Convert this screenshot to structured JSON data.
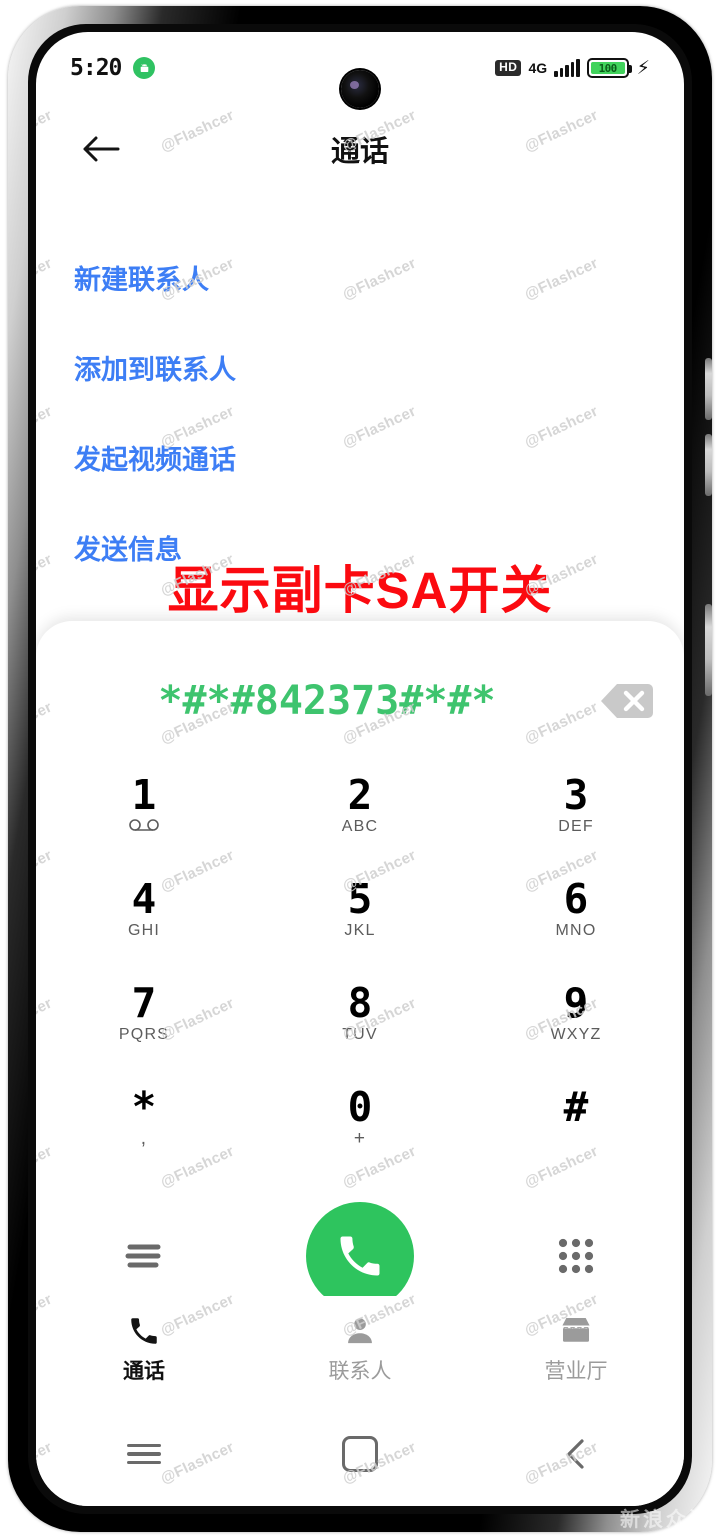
{
  "status_bar": {
    "clock": "5:20",
    "notification_icon": "android-robot-icon",
    "volte_badge": "HD",
    "network_type": "4G",
    "signal_icon": "signal-bars-icon",
    "battery_level": "100",
    "charging_icon": "charging-bolt-icon"
  },
  "header": {
    "back_icon": "back-arrow-icon",
    "title": "通话"
  },
  "action_links": [
    {
      "label": "新建联系人"
    },
    {
      "label": "添加到联系人"
    },
    {
      "label": "发起视频通话"
    },
    {
      "label": "发送信息"
    }
  ],
  "annotation": {
    "text": "显示副卡SA开关",
    "color": "#fb0a10"
  },
  "dialpad": {
    "dialed_number": "*#*#842373#*#*",
    "dialed_number_color": "#3ec46e",
    "backspace_icon": "backspace-icon",
    "keys": [
      {
        "digit": "1",
        "sub": "",
        "sub_icon": "voicemail-icon"
      },
      {
        "digit": "2",
        "sub": "ABC"
      },
      {
        "digit": "3",
        "sub": "DEF"
      },
      {
        "digit": "4",
        "sub": "GHI"
      },
      {
        "digit": "5",
        "sub": "JKL"
      },
      {
        "digit": "6",
        "sub": "MNO"
      },
      {
        "digit": "7",
        "sub": "PQRS"
      },
      {
        "digit": "8",
        "sub": "TUV"
      },
      {
        "digit": "9",
        "sub": "WXYZ"
      },
      {
        "digit": "*",
        "sub": ","
      },
      {
        "digit": "0",
        "sub": "+"
      },
      {
        "digit": "#",
        "sub": ""
      }
    ],
    "actions": {
      "menu_icon": "call-log-list-icon",
      "call_icon": "phone-handset-icon",
      "call_button_color": "#2ec45e",
      "keypad_toggle_icon": "dialpad-dots-icon"
    }
  },
  "tab_bar": {
    "items": [
      {
        "label": "通话",
        "icon": "phone-handset-icon",
        "active": true
      },
      {
        "label": "联系人",
        "icon": "person-icon",
        "active": false
      },
      {
        "label": "营业厅",
        "icon": "store-icon",
        "active": false
      }
    ]
  },
  "nav_bar": {
    "recents_icon": "recents-lines-icon",
    "home_icon": "home-square-icon",
    "back_icon": "nav-back-chevron-icon"
  },
  "watermark": {
    "text": "@Flashcer",
    "corner_text": "新浪众测"
  }
}
